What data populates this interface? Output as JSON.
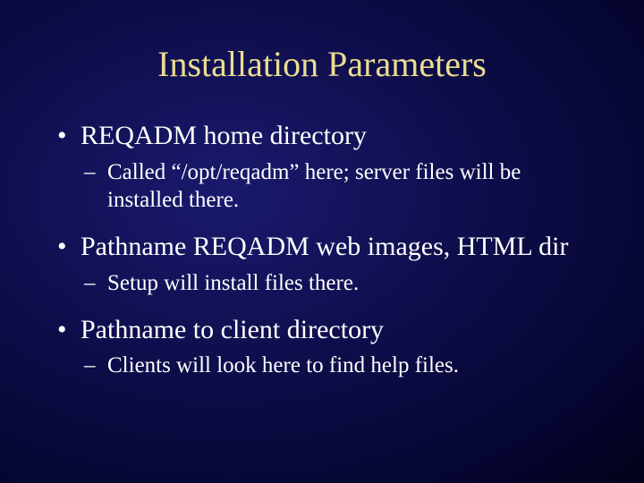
{
  "title": "Installation Parameters",
  "bullets": [
    {
      "text": "REQADM home directory",
      "sub": [
        "Called “/opt/reqadm” here; server files will be installed there."
      ]
    },
    {
      "text": "Pathname REQADM web images, HTML dir",
      "sub": [
        "Setup will install files there."
      ]
    },
    {
      "text": "Pathname to client directory",
      "sub": [
        "Clients will look here to find help files."
      ]
    }
  ]
}
